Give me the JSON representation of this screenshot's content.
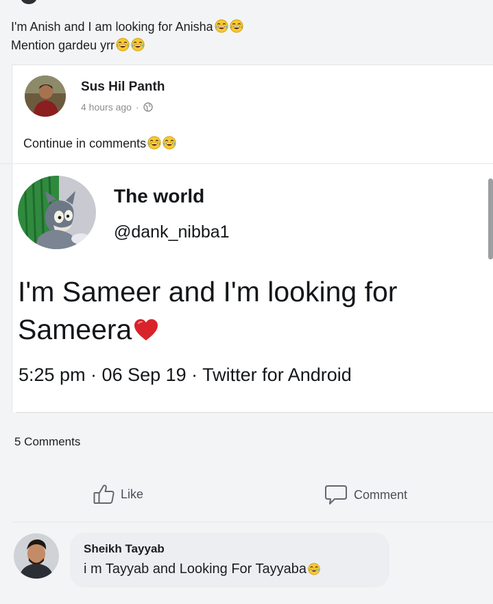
{
  "post": {
    "caption_line1": "I'm Anish and I am looking for Anisha",
    "caption_line2": "Mention gardeu yrr"
  },
  "shared_post": {
    "author": "Sus Hil Panth",
    "time": "4 hours ago",
    "separator": "·",
    "text": "Continue in comments"
  },
  "tweet": {
    "name": "The world",
    "handle": "@dank_nibba1",
    "body": "I'm Sameer and I'm looking for Sameera",
    "meta": "5:25 pm · 06 Sep 19 · Twitter for Android"
  },
  "footer": {
    "comments_count": "5 Comments",
    "like_label": "Like",
    "comment_label": "Comment"
  },
  "comment": {
    "author": "Sheikh Tayyab",
    "text": "i m Tayyab and Looking For Tayyaba"
  },
  "icons": {
    "laugh": "laughing-emoji",
    "heart": "red-heart-emoji",
    "globe": "globe-icon",
    "like": "thumbs-up-icon",
    "comment": "speech-bubble-icon"
  },
  "colors": {
    "name_text": "#1c1e21",
    "meta_text": "#8a8d91",
    "action_text": "#4b4f56",
    "bubble": "#eceef1",
    "heart": "#d8232a"
  }
}
